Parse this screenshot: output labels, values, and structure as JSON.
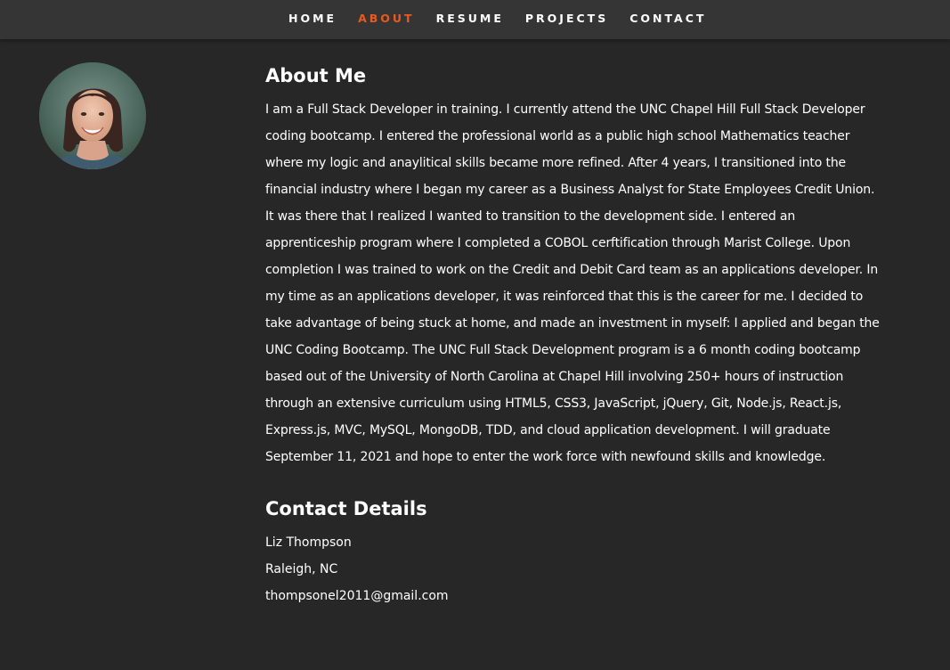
{
  "nav": {
    "items": [
      {
        "label": "HOME"
      },
      {
        "label": "ABOUT"
      },
      {
        "label": "RESUME"
      },
      {
        "label": "PROJECTS"
      },
      {
        "label": "CONTACT"
      }
    ],
    "active_item": "ABOUT",
    "active_color": "#e85a1f"
  },
  "profile": {
    "avatar_icon": "profile-photo"
  },
  "about": {
    "title": "About Me",
    "text": "I am a Full Stack Developer in training. I currently attend the UNC Chapel Hill Full Stack Developer coding bootcamp. I entered the professional world as a public high school Mathematics teacher where my logic and anaylitical skills became more refined. After 4 years, I transitioned into the financial industry where I began my career as a Business Analyst for State Employees Credit Union. It was there that I realized I wanted to transition to the development side. I entered an apprenticeship program where I completed a COBOL cerftification through Marist College. Upon completion I was trained to work on the Credit and Debit Card team as an applications developer. In my time as an applications developer, it was reinforced that this is the career for me. I decided to take advantage of being stuck at home, and made an investment in myself: I applied and began the UNC Coding Bootcamp. The UNC Full Stack Development program is a 6 month coding bootcamp based out of the University of North Carolina at Chapel Hill involving 250+ hours of instruction through an extensive curriculum using HTML5, CSS3, JavaScript, jQuery, Git, Node.js, React.js, Express.js, MVC, MySQL, MongoDB, TDD, and cloud application development. I will graduate September 11, 2021 and hope to enter the work force with newfound skills and knowledge."
  },
  "contact": {
    "title": "Contact Details",
    "name": "Liz Thompson",
    "location": "Raleigh, NC",
    "email": "thompsonel2011@gmail.com"
  }
}
